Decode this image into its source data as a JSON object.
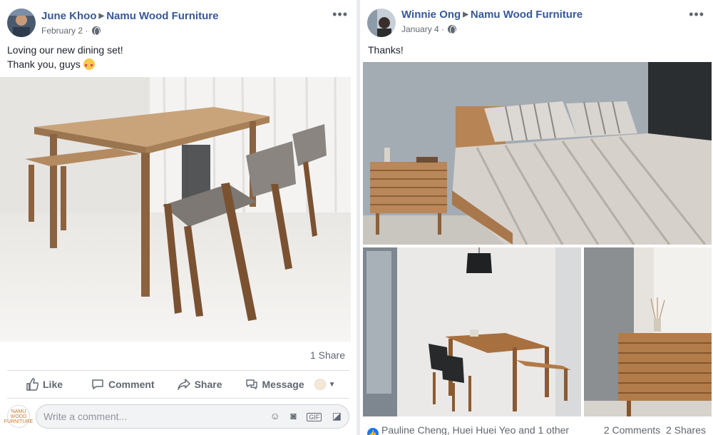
{
  "post1": {
    "author": "June Khoo",
    "page": "Namu Wood Furniture",
    "date": "February 2",
    "text_line1": "Loving our new dining set!",
    "text_line2": "Thank you, guys",
    "shares": "1 Share",
    "actions": {
      "like": "Like",
      "comment": "Comment",
      "share": "Share",
      "message": "Message"
    },
    "comment_placeholder": "Write a comment...",
    "page_avatar_text": "NAMU WOOD FURNITURE"
  },
  "post2": {
    "author": "Winnie Ong",
    "page": "Namu Wood Furniture",
    "date": "January 4",
    "text": "Thanks!",
    "reactions": "Pauline Cheng, Huei Huei Yeo and 1 other",
    "comments": "2 Comments",
    "shares": "2 Shares"
  },
  "colors": {
    "link": "#385898",
    "meta": "#606770",
    "like_blue": "#1877f2"
  },
  "icons": [
    "globe-icon",
    "more-options-icon",
    "like-icon",
    "comment-icon",
    "share-icon",
    "message-icon",
    "emoji-icon",
    "camera-icon",
    "gif-icon",
    "sticker-icon"
  ]
}
